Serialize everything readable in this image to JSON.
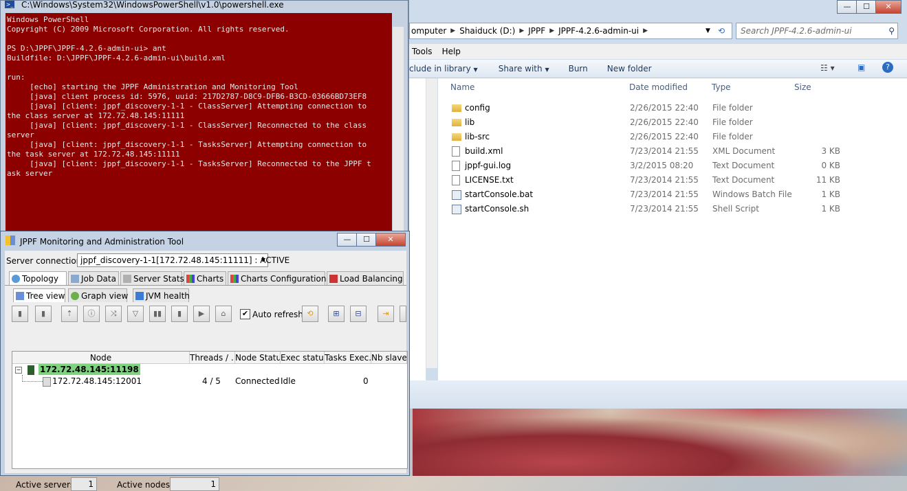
{
  "powershell": {
    "title": "C:\\Windows\\System32\\WindowsPowerShell\\v1.0\\powershell.exe",
    "console_lines": [
      "Windows PowerShell",
      "Copyright (C) 2009 Microsoft Corporation. All rights reserved.",
      "",
      "PS D:\\JPPF\\JPPF-4.2.6-admin-ui> ant",
      "Buildfile: D:\\JPPF\\JPPF-4.2.6-admin-ui\\build.xml",
      "",
      "run:",
      "     [echo] starting the JPPF Administration and Monitoring Tool",
      "     [java] client process id: 5976, uuid: 217D2787-D8C9-DFB6-B3CD-03666BD73EF8",
      "     [java] [client: jppf_discovery-1-1 - ClassServer] Attempting connection to",
      "the class server at 172.72.48.145:11111",
      "     [java] [client: jppf_discovery-1-1 - ClassServer] Reconnected to the class",
      "server",
      "     [java] [client: jppf_discovery-1-1 - TasksServer] Attempting connection to",
      "the task server at 172.72.48.145:11111",
      "     [java] [client: jppf_discovery-1-1 - TasksServer] Reconnected to the JPPF t",
      "ask server"
    ]
  },
  "explorer": {
    "window_buttons": {
      "minimize": "—",
      "maximize": "☐",
      "close": "✕"
    },
    "breadcrumb": [
      "omputer",
      "Shaiduck (D:)",
      "JPPF",
      "JPPF-4.2.6-admin-ui"
    ],
    "search_placeholder": "Search JPPF-4.2.6-admin-ui",
    "menu": [
      "Tools",
      "Help"
    ],
    "commands": [
      "clude in library",
      "Share with",
      "Burn",
      "New folder"
    ],
    "columns": {
      "name": "Name",
      "date": "Date modified",
      "type": "Type",
      "size": "Size"
    },
    "files": [
      {
        "name": "config",
        "date": "2/26/2015 22:40",
        "type": "File folder",
        "size": "",
        "kind": "folder"
      },
      {
        "name": "lib",
        "date": "2/26/2015 22:40",
        "type": "File folder",
        "size": "",
        "kind": "folder"
      },
      {
        "name": "lib-src",
        "date": "2/26/2015 22:40",
        "type": "File folder",
        "size": "",
        "kind": "folder"
      },
      {
        "name": "build.xml",
        "date": "7/23/2014 21:55",
        "type": "XML Document",
        "size": "3 KB",
        "kind": "xml"
      },
      {
        "name": "jppf-gui.log",
        "date": "3/2/2015 08:20",
        "type": "Text Document",
        "size": "0 KB",
        "kind": "text"
      },
      {
        "name": "LICENSE.txt",
        "date": "7/23/2014 21:55",
        "type": "Text Document",
        "size": "11 KB",
        "kind": "text"
      },
      {
        "name": "startConsole.bat",
        "date": "7/23/2014 21:55",
        "type": "Windows Batch File",
        "size": "1 KB",
        "kind": "bat"
      },
      {
        "name": "startConsole.sh",
        "date": "7/23/2014 21:55",
        "type": "Shell Script",
        "size": "1 KB",
        "kind": "bat"
      }
    ]
  },
  "jppf": {
    "title": "JPPF Monitoring and Administration Tool",
    "server_connection_label": "Server connection",
    "server_connection_value": "jppf_discovery-1-1[172.72.48.145:11111] : ACTIVE",
    "main_tabs": [
      "Topology",
      "Job Data",
      "Server Stats",
      "Charts",
      "Charts Configuration",
      "Load Balancing"
    ],
    "sub_tabs": [
      "Tree view",
      "Graph view",
      "JVM health"
    ],
    "auto_refresh_label": "Auto refresh",
    "table_headers": [
      "Node",
      "Threads / ...",
      "Node Status",
      "Exec status",
      "Tasks Exec...",
      "Nb slave"
    ],
    "server_row": "172.72.48.145:11198",
    "node_row": {
      "node": "172.72.48.145:12001",
      "threads": "4 / 5",
      "status": "Connected",
      "exec": "Idle",
      "tasks": "0"
    },
    "active_servers_label": "Active servers",
    "active_servers_value": "1",
    "active_nodes_label": "Active nodes",
    "active_nodes_value": "1"
  },
  "colors": {
    "console_bg": "#8c0000",
    "server_highlight": "#7fd27f"
  }
}
